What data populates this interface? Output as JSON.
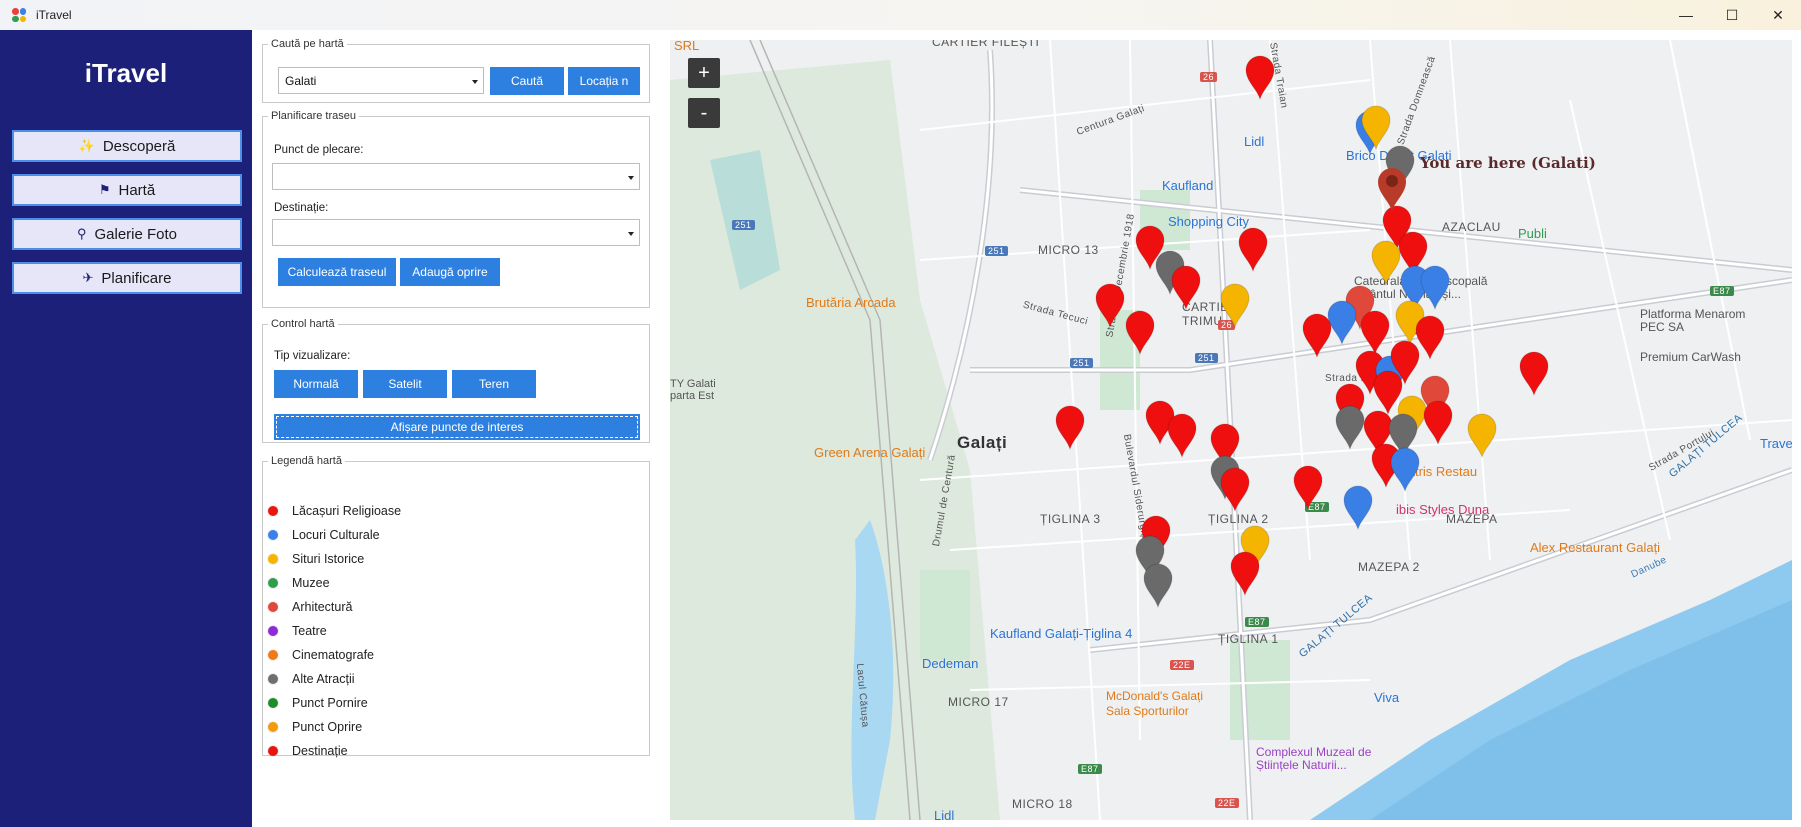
{
  "window": {
    "title": "iTravel",
    "minimize_glyph": "—",
    "maximize_glyph": "☐",
    "close_glyph": "✕"
  },
  "sidebar": {
    "brand": "iTravel",
    "items": [
      {
        "label": "Descoperă",
        "icon": "sparkle-icon",
        "glyph": "✨"
      },
      {
        "label": "Hartă",
        "icon": "flag-icon",
        "glyph": "⚑"
      },
      {
        "label": "Galerie Foto",
        "icon": "search-icon",
        "glyph": "⚲"
      },
      {
        "label": "Planificare",
        "icon": "airplane-icon",
        "glyph": "✈"
      }
    ]
  },
  "search_group": {
    "title": "Caută pe hartă",
    "city_value": "Galati",
    "search_button": "Caută",
    "location_button": "Locația n"
  },
  "route_group": {
    "title": "Planificare traseu",
    "start_label": "Punct de plecare:",
    "start_value": "",
    "dest_label": "Destinație:",
    "dest_value": "",
    "calc_button": "Calculează traseul",
    "add_stop_button": "Adaugă oprire"
  },
  "control_group": {
    "title": "Control hartă",
    "view_label": "Tip vizualizare:",
    "normal_button": "Normală",
    "satellite_button": "Satelit",
    "terrain_button": "Teren",
    "poi_button": "Afișare puncte de interes"
  },
  "legend_group": {
    "title": "Legendă hartă",
    "items": [
      {
        "label": "Lăcașuri Religioase",
        "color": "#e8170f"
      },
      {
        "label": "Locuri Culturale",
        "color": "#3a80e8"
      },
      {
        "label": "Situri Istorice",
        "color": "#f5b400"
      },
      {
        "label": "Muzee",
        "color": "#2f9e4f"
      },
      {
        "label": "Arhitectură",
        "color": "#e0483a"
      },
      {
        "label": "Teatre",
        "color": "#8e2ad6"
      },
      {
        "label": "Cinematografe",
        "color": "#f07a18"
      },
      {
        "label": "Alte Atracții",
        "color": "#6f6f6f"
      },
      {
        "label": "Punct Pornire",
        "color": "#1e8c2a"
      },
      {
        "label": "Punct Oprire",
        "color": "#f59a0a"
      },
      {
        "label": "Destinație",
        "color": "#e4160e"
      }
    ]
  },
  "map": {
    "zoom_in": "+",
    "zoom_out": "-",
    "you_are_here": "You are here (Galati)",
    "district_labels": [
      "CARTIER FILEȘTI",
      "MICRO 13",
      "CARTIER\nTRIMU",
      "AZACLAU",
      "Galați",
      "ȚIGLINA 3",
      "ȚIGLINA 2",
      "ȚIGLINA 1",
      "MAZEPA 2",
      "MAZEPA",
      "MICRO 17",
      "MICRO 18"
    ],
    "road_labels": [
      "Centura Galați",
      "Strada Traian",
      "Strada Domnească",
      "Strada Tecuci",
      "Strada 1 Decembrie 1918",
      "Strada Movilei",
      "Strada Portului",
      "Bulevardul Siderurgiștilor",
      "Drumul de Centură",
      "Lacul Cătușa",
      "Danube",
      "GALAȚI TULCEA"
    ],
    "route_shields": [
      "26",
      "251",
      "E87",
      "22E"
    ],
    "poi_labels": [
      {
        "label": "SRL",
        "color": "#e07a18"
      },
      {
        "label": "Lidl",
        "color": "#2a74d6"
      },
      {
        "label": "Brico Depot Galați",
        "color": "#2a74d6"
      },
      {
        "label": "Kaufland",
        "color": "#2a74d6"
      },
      {
        "label": "Shopping City",
        "color": "#2a74d6"
      },
      {
        "label": "Brutăria Arcada",
        "color": "#e07a18"
      },
      {
        "label": "Catedrala Arhiepiscopală \"Sfântul Nicolae și...",
        "color": "#555555"
      },
      {
        "label": "Platforma Menarom PEC SA",
        "color": "#555555"
      },
      {
        "label": "Premium CarWash",
        "color": "#555555"
      },
      {
        "label": "TY Galati parta Est",
        "color": "#555555"
      },
      {
        "label": "Green Arena Galați",
        "color": "#e07a18"
      },
      {
        "label": "Teatris Restau",
        "color": "#e07a18"
      },
      {
        "label": "ibis Styles Duna",
        "color": "#d0346a"
      },
      {
        "label": "Alex Restaurant Galați",
        "color": "#e07a18"
      },
      {
        "label": "Kaufland Galați-Țiglina 4",
        "color": "#2a74d6"
      },
      {
        "label": "Dedeman",
        "color": "#2a74d6"
      },
      {
        "label": "McDonald's Galați",
        "color": "#e07a18"
      },
      {
        "label": "Sala Sporturilor",
        "color": "#e07a18"
      },
      {
        "label": "Complexul Muzeal de Științele Naturii...",
        "color": "#9b3fc4"
      },
      {
        "label": "Viva",
        "color": "#2a74d6"
      },
      {
        "label": "Trave",
        "color": "#2a74d6"
      },
      {
        "label": "Lidl",
        "color": "#2a74d6"
      },
      {
        "label": "Publi",
        "color": "#2f9e4f"
      }
    ],
    "marker_colors": {
      "red": "#f00f0f",
      "gray": "#6a6a6a",
      "yellow": "#f5b400",
      "blue": "#3a7fe6",
      "coral": "#e0483a",
      "here": "#b83b2a"
    }
  }
}
